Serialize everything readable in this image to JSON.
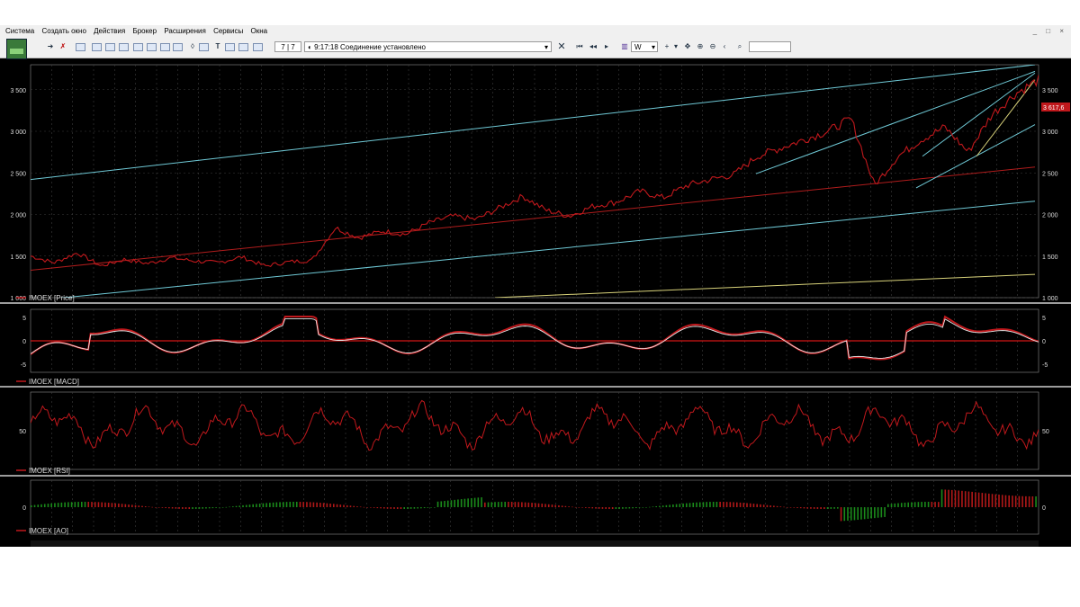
{
  "menu": [
    "Система",
    "Создать окно",
    "Действия",
    "Брокер",
    "Расширения",
    "Сервисы",
    "Окна"
  ],
  "window_controls": [
    "_",
    "□",
    "×"
  ],
  "toolbar": {
    "account_field": "7 | 7",
    "status_time": "9:17:18",
    "status_text": "Соединение установлено",
    "interval": "W",
    "search_value": ""
  },
  "icons": [
    "app-logo-icon",
    "cursor-icon",
    "delete-icon",
    "new-chart-icon",
    "window-icon",
    "table-icon",
    "orders-icon",
    "text-icon",
    "line-icon",
    "connect-icon",
    "nav-first-icon",
    "nav-prev-icon",
    "chart-type-icon",
    "crosshair-icon",
    "move-icon",
    "zoom-in-icon",
    "zoom-out-icon",
    "search-icon"
  ],
  "price_pane": {
    "label": "IMOEX [Price]",
    "y_ticks": [
      1000,
      1500,
      2000,
      2500,
      3000,
      3500
    ],
    "y_tick_labels": [
      "1 000",
      "1 500",
      "2 000",
      "2 500",
      "3 000",
      "3 500"
    ],
    "last_price": "3 617,6",
    "colors": {
      "series": "#c0181c",
      "trend_cyan": "#6fc9d6",
      "trend_yellow": "#d8d27a",
      "trend_red": "#b01c1c"
    }
  },
  "macd_pane": {
    "label": "IMOEX [MACD]",
    "y_ticks": [
      5,
      0,
      -5
    ],
    "y_tick_labels": [
      "5",
      "0",
      "-5"
    ],
    "colors": {
      "macd": "#c0181c",
      "signal": "#e8e8e8",
      "zero": "#d21515"
    }
  },
  "rsi_pane": {
    "label": "IMOEX [RSI]",
    "y_ticks": [
      50
    ],
    "y_tick_labels": [
      "50"
    ]
  },
  "ao_pane": {
    "label": "IMOEX [AO]",
    "y_ticks": [
      0
    ],
    "y_tick_labels": [
      "0"
    ],
    "colors": {
      "up": "#1a8a1a",
      "down": "#b01818"
    }
  },
  "chart_data": {
    "type": "line",
    "instrument": "IMOEX",
    "interval": "W",
    "ylim": [
      1000,
      3800
    ],
    "grid": true,
    "series": [
      {
        "name": "IMOEX [Price]",
        "approx_path_values": [
          1500,
          1420,
          1540,
          1380,
          1460,
          1410,
          1480,
          1440,
          1420,
          1490,
          1380,
          1430,
          1450,
          1840,
          1720,
          1800,
          1760,
          1900,
          1980,
          1940,
          2080,
          2220,
          2050,
          1980,
          2100,
          2150,
          2280,
          2200,
          2350,
          2420,
          2480,
          2700,
          2800,
          2900,
          3000,
          3150,
          2350,
          2700,
          2900,
          3050,
          2750,
          3200,
          3450,
          3617.6
        ]
      }
    ],
    "trendlines": 7
  }
}
